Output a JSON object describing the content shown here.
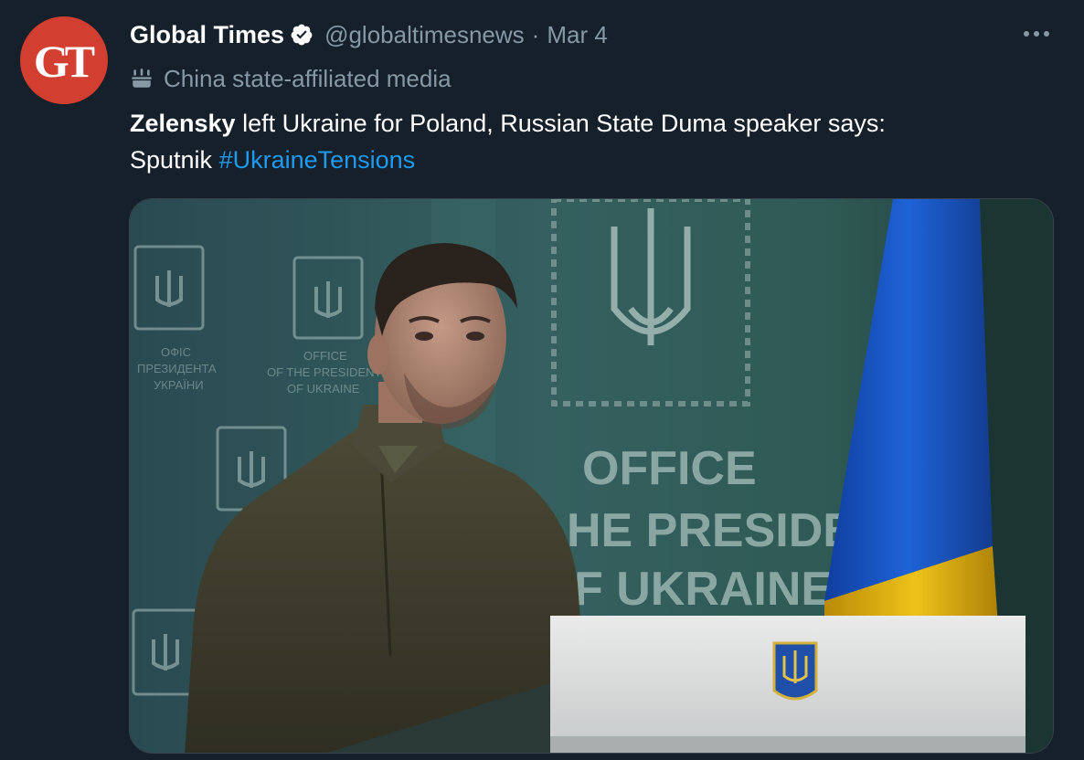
{
  "tweet": {
    "avatar_text": "GT",
    "display_name": "Global Times",
    "handle": "@globaltimesnews",
    "separator": "·",
    "date": "Mar 4",
    "label": "China state-affiliated media",
    "text_bold": "Zelensky",
    "text_rest": " left Ukraine for Poland, Russian State Duma speaker says:",
    "text_line2": "Sputnik ",
    "hashtag": "#UkraineTensions"
  },
  "media": {
    "backdrop_line1": "OFFICE",
    "backdrop_line2": "HE PRESIDENT",
    "backdrop_line3": "F UKRAINE",
    "small_text_1": "OFFICE",
    "small_text_2": "OF THE PRESIDENT",
    "small_text_3": "OF UKRAINE",
    "small_text_4": "ОФІС",
    "small_text_5": "ПРЕЗИДЕНТА",
    "small_text_6": "УКРАЇНИ"
  },
  "colors": {
    "background": "#15202b",
    "accent": "#1d9bf0",
    "muted": "#8899a6",
    "avatar": "#d23f31",
    "flag_blue": "#1a56c4",
    "flag_yellow": "#e8b80c"
  },
  "icons": [
    "verified-badge-icon",
    "state-media-icon",
    "more-options-icon"
  ]
}
